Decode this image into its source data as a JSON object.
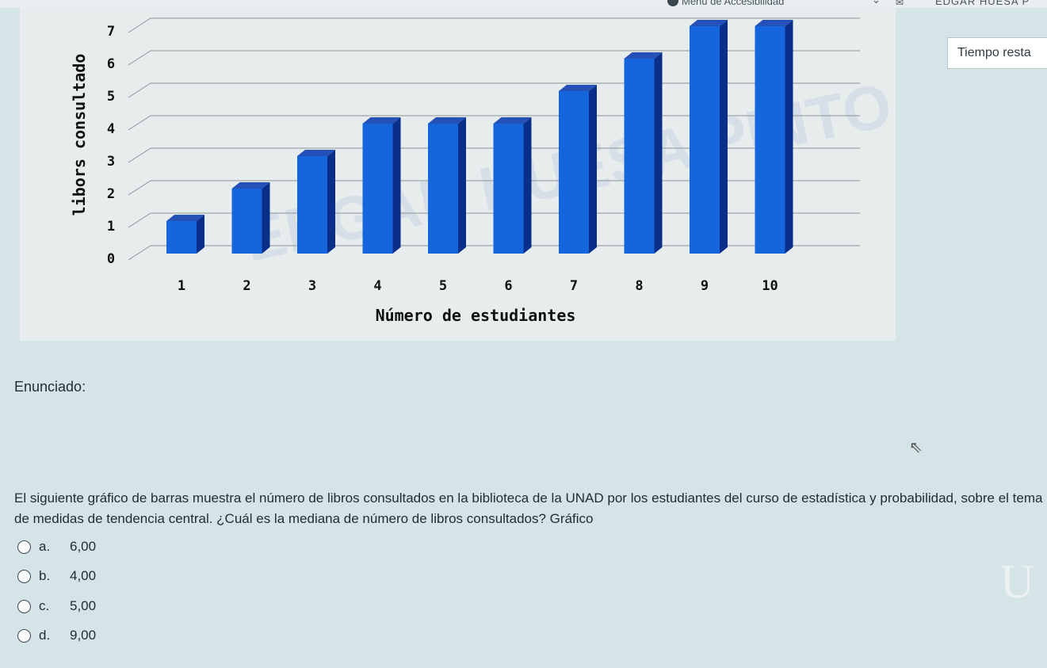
{
  "header": {
    "accessibility_menu": "Menú de Accesibilidad",
    "user_name": "EDGAR HUESA P"
  },
  "timer": {
    "label": "Tiempo resta"
  },
  "chart_data": {
    "type": "bar",
    "categories": [
      "1",
      "2",
      "3",
      "4",
      "5",
      "6",
      "7",
      "8",
      "9",
      "10"
    ],
    "values": [
      1,
      2,
      3,
      4,
      4,
      4,
      5,
      6,
      7,
      7
    ],
    "xlabel": "Número de estudiantes",
    "ylabel": "libors consultado",
    "ylim": [
      0,
      7
    ],
    "yticks": [
      "0",
      "1",
      "2",
      "3",
      "4",
      "5",
      "6",
      "7"
    ],
    "grid": true,
    "watermark": "EDGAR HUESA PINTO",
    "colors": {
      "bar_front": "#1565dd",
      "bar_side": "#0a2f8a",
      "bar_top": "#2450b8",
      "grid": "#8a9499"
    }
  },
  "question": {
    "heading": "Enunciado:",
    "text": "El siguiente gráfico de barras muestra el número de libros consultados en la biblioteca de la UNAD por los estudiantes del curso de estadística y probabilidad, sobre el tema de medidas de tendencia central. ¿Cuál es la mediana de número de libros consultados? Gráfico",
    "options": [
      {
        "letter": "a.",
        "value": "6,00"
      },
      {
        "letter": "b.",
        "value": "4,00"
      },
      {
        "letter": "c.",
        "value": "5,00"
      },
      {
        "letter": "d.",
        "value": "9,00"
      }
    ]
  }
}
